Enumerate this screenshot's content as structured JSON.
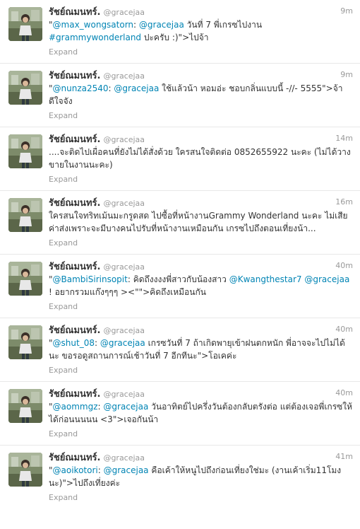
{
  "tweets": [
    {
      "fullname": "รัชย์ณมนทร์.",
      "username": "@gracejaa",
      "time": "9m",
      "segments": [
        {
          "text": "\"",
          "link": false
        },
        {
          "text": "@max_wongsatorn",
          "link": true
        },
        {
          "text": ": ",
          "link": false
        },
        {
          "text": "@gracejaa",
          "link": true
        },
        {
          "text": " วันที่ 7 พี่เกรซไปงาน ",
          "link": false
        },
        {
          "text": "#grammywonderland",
          "link": true
        },
        {
          "text": " ปะครับ :)\">ไปจ้า",
          "link": false
        }
      ],
      "expand": "Expand"
    },
    {
      "fullname": "รัชย์ณมนทร์.",
      "username": "@gracejaa",
      "time": "9m",
      "segments": [
        {
          "text": "\"",
          "link": false
        },
        {
          "text": "@nunza2540",
          "link": true
        },
        {
          "text": ": ",
          "link": false
        },
        {
          "text": "@gracejaa",
          "link": true
        },
        {
          "text": " ใช้แล้วน้า หอมอ่ะ ชอบกลิ่นแบบนี้ -//- 5555\">จ้า ดีใจจัง",
          "link": false
        }
      ],
      "expand": "Expand"
    },
    {
      "fullname": "รัชย์ณมนทร์.",
      "username": "@gracejaa",
      "time": "14m",
      "segments": [
        {
          "text": "....จะติดไปเผื่อคนที่ยังไม่ได้สั่งด้วย ใครสนใจติดต่อ 0852655922 นะคะ (ไม่ได้วางขายในงานนะคะ)",
          "link": false
        }
      ],
      "expand": "Expand"
    },
    {
      "fullname": "รัชย์ณมนทร์.",
      "username": "@gracejaa",
      "time": "16m",
      "segments": [
        {
          "text": "ใครสนใจทริทเม้นมะกรูดสด ไปซื้อที่หน้างานGrammy Wonderland นะคะ ไม่เสียค่าส่งเพราะจะมีบางคนไปรับที่หน้างานเหมือนกัน เกรซไปถึงตอนเที่ยงน้า...",
          "link": false
        }
      ],
      "expand": "Expand"
    },
    {
      "fullname": "รัชย์ณมนทร์.",
      "username": "@gracejaa",
      "time": "40m",
      "segments": [
        {
          "text": "\"",
          "link": false
        },
        {
          "text": "@BambiSirinsopit",
          "link": true
        },
        {
          "text": ": คิดถึงงงงพี่สาวกับน้องสาว ",
          "link": false
        },
        {
          "text": "@Kwangthestar7",
          "link": true
        },
        {
          "text": " ",
          "link": false
        },
        {
          "text": "@gracejaa",
          "link": true
        },
        {
          "text": " ! อยากรวมแก๊งๆๆๆ ><\"\">คิดถึงเหมือนกัน",
          "link": false
        }
      ],
      "expand": "Expand"
    },
    {
      "fullname": "รัชย์ณมนทร์.",
      "username": "@gracejaa",
      "time": "40m",
      "segments": [
        {
          "text": "\"",
          "link": false
        },
        {
          "text": "@shut_08",
          "link": true
        },
        {
          "text": ": ",
          "link": false
        },
        {
          "text": "@gracejaa",
          "link": true
        },
        {
          "text": " เกรซวันที่ 7 ถ้าเกิดพายุเข้าฝนตกหนัก พี่อาจจะไปไม่ได้นะ ขอรอดูสถานการณ์เช้าวันที่ 7 อีกทีนะ\">โอเคค่ะ",
          "link": false
        }
      ],
      "expand": "Expand"
    },
    {
      "fullname": "รัชย์ณมนทร์.",
      "username": "@gracejaa",
      "time": "40m",
      "segments": [
        {
          "text": "\"",
          "link": false
        },
        {
          "text": "@aommgz",
          "link": true
        },
        {
          "text": ": ",
          "link": false
        },
        {
          "text": "@gracejaa",
          "link": true
        },
        {
          "text": " วันอาทิตย์ไปครึ่งวันต้องกลับตรังต่อ แต่ต้องเจอพี่เกรซให้ได้ก่อนนนนน <3\">เจอกันน้า",
          "link": false
        }
      ],
      "expand": "Expand"
    },
    {
      "fullname": "รัชย์ณมนทร์.",
      "username": "@gracejaa",
      "time": "41m",
      "segments": [
        {
          "text": "\"",
          "link": false
        },
        {
          "text": "@aoikotori",
          "link": true
        },
        {
          "text": ": ",
          "link": false
        },
        {
          "text": "@gracejaa",
          "link": true
        },
        {
          "text": " คือเค้าให้หนูไปถึงก่อนเที่ยงใช่มะ (งานเค้าเริ่ม11โมงนะ)\">ไปถึงเที่ยงค่ะ",
          "link": false
        }
      ],
      "expand": "Expand"
    }
  ]
}
